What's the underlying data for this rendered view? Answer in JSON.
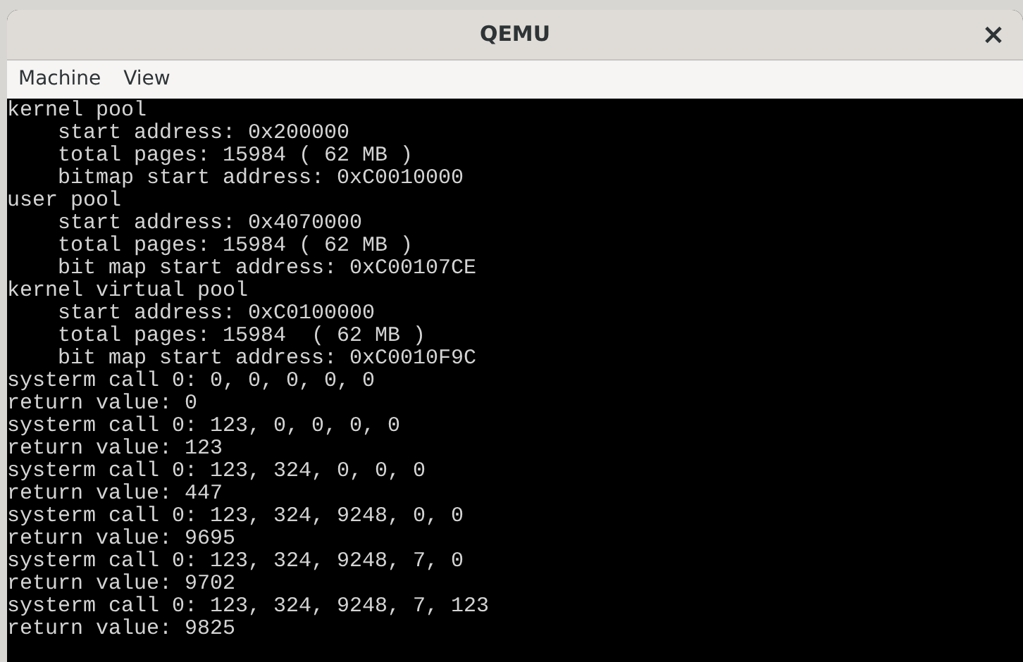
{
  "window": {
    "title": "QEMU",
    "close": "×"
  },
  "menu": [
    "Machine",
    "View"
  ],
  "console": {
    "lines": [
      "kernel pool",
      "    start address: 0x200000",
      "    total pages: 15984 ( 62 MB )",
      "    bitmap start address: 0xC0010000",
      "user pool",
      "    start address: 0x4070000",
      "    total pages: 15984 ( 62 MB )",
      "    bit map start address: 0xC00107CE",
      "kernel virtual pool",
      "    start address: 0xC0100000",
      "    total pages: 15984  ( 62 MB )",
      "    bit map start address: 0xC0010F9C",
      "systerm call 0: 0, 0, 0, 0, 0",
      "return value: 0",
      "systerm call 0: 123, 0, 0, 0, 0",
      "return value: 123",
      "systerm call 0: 123, 324, 0, 0, 0",
      "return value: 447",
      "systerm call 0: 123, 324, 9248, 0, 0",
      "return value: 9695",
      "systerm call 0: 123, 324, 9248, 7, 0",
      "return value: 9702",
      "systerm call 0: 123, 324, 9248, 7, 123",
      "return value: 9825"
    ]
  }
}
